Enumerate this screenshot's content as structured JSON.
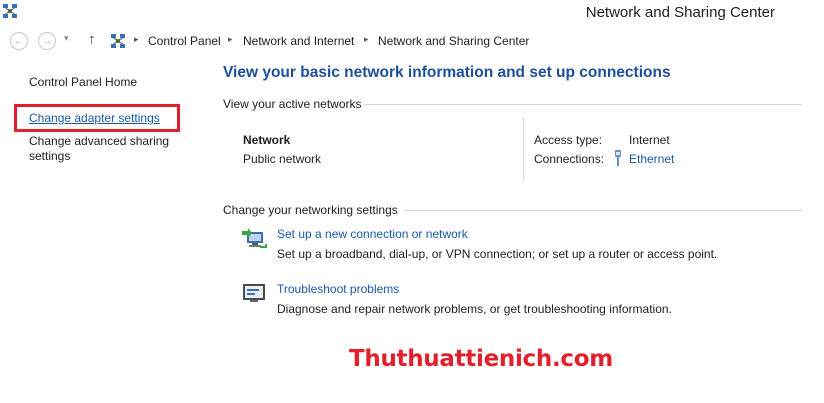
{
  "window": {
    "title": "Network and Sharing Center"
  },
  "breadcrumb": [
    "Control Panel",
    "Network and Internet",
    "Network and Sharing Center"
  ],
  "icons": {
    "back": "back-arrow-icon",
    "forward": "forward-arrow-icon",
    "recent": "chevron-down-icon",
    "up": "up-arrow-icon",
    "network": "network-icon",
    "ethernet": "ethernet-icon",
    "setup": "setup-connection-icon",
    "troubleshoot": "troubleshoot-icon"
  },
  "nav": {
    "back_glyph": "←",
    "forward_glyph": "→",
    "recent_glyph": "▾",
    "up_glyph": "↑",
    "sep_glyph": "▸"
  },
  "sidebar": {
    "home": "Control Panel Home",
    "adapter": "Change adapter settings",
    "sharing": "Change advanced sharing settings"
  },
  "main": {
    "heading": "View your basic network information and set up connections",
    "active_label": "View your active networks",
    "network": {
      "name": "Network",
      "type": "Public network",
      "access_label": "Access type:",
      "access_value": "Internet",
      "connections_label": "Connections:",
      "connections_value": "Ethernet"
    },
    "change_label": "Change your networking settings",
    "tasks": [
      {
        "link": "Set up a new connection or network",
        "desc": "Set up a broadband, dial-up, or VPN connection; or set up a router or access point."
      },
      {
        "link": "Troubleshoot problems",
        "desc": "Diagnose and repair network problems, or get troubleshooting information."
      }
    ]
  },
  "watermark": "Thuthuattienich.com",
  "colors": {
    "link": "#1a5aa8",
    "heading": "#1f4e9a",
    "highlight": "#e0202a"
  }
}
